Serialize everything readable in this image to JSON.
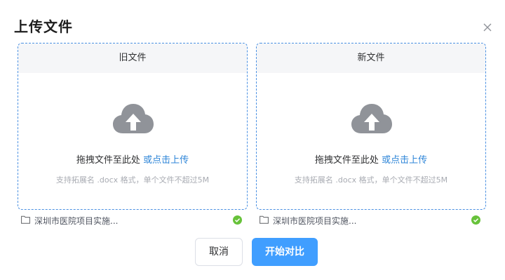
{
  "dialog": {
    "title": "上传文件",
    "close_icon": "close-icon"
  },
  "panels": [
    {
      "header": "旧文件",
      "drag_text": "拖拽文件至此处 ",
      "click_text": "或点击上传",
      "tip": "支持拓展名 .docx 格式，单个文件不超过5M",
      "file_name": "深圳市医院项目实施...",
      "upload_status": "success"
    },
    {
      "header": "新文件",
      "drag_text": "拖拽文件至此处 ",
      "click_text": "或点击上传",
      "tip": "支持拓展名 .docx 格式，单个文件不超过5M",
      "file_name": "深圳市医院项目实施...",
      "upload_status": "success"
    }
  ],
  "footer": {
    "cancel_label": "取消",
    "start_label": "开始对比"
  },
  "colors": {
    "accent": "#409eff",
    "link": "#2f86d8",
    "dashed_border": "#4a90e2",
    "success": "#67c23a",
    "cloud": "#909399"
  },
  "icons": [
    "upload-cloud-icon",
    "folder-icon",
    "success-check-icon",
    "close-icon"
  ]
}
